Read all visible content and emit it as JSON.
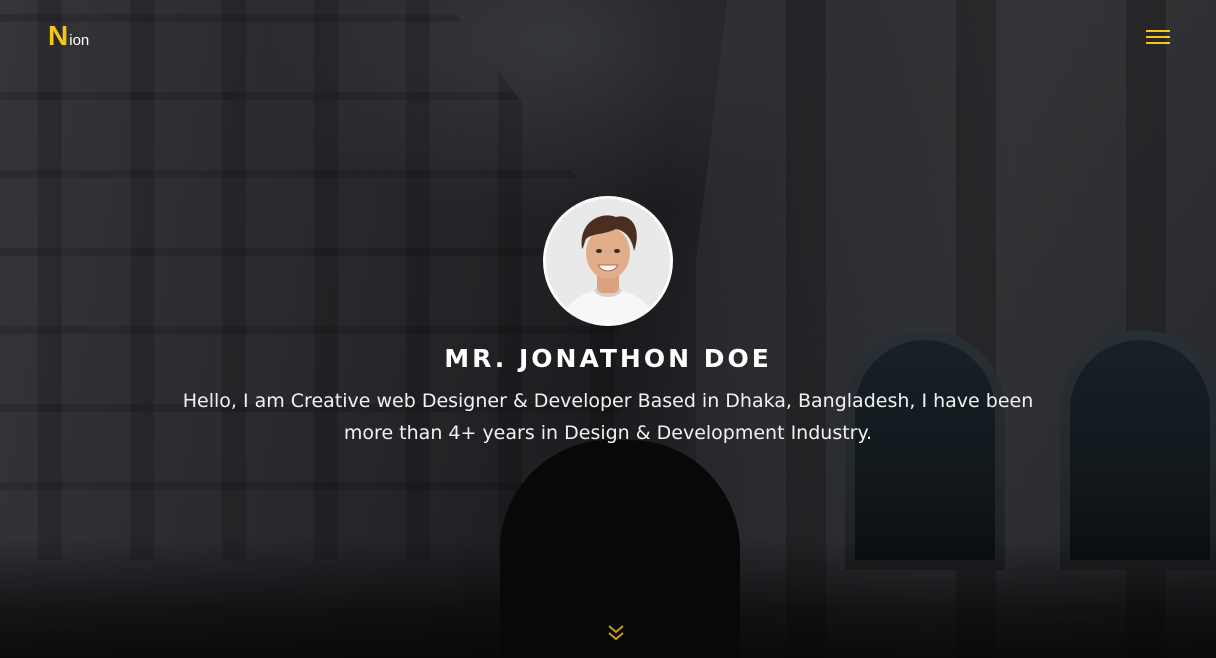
{
  "brand": {
    "mark": "N",
    "text": "ion",
    "accent_color": "#f5c518"
  },
  "nav": {
    "menu_icon": "hamburger-menu-icon"
  },
  "profile": {
    "name": "MR. JONATHON DOE",
    "bio": "Hello, I am Creative web Designer & Developer Based in Dhaka, Bangladesh, I have been more than 4+ years in Design & Development Industry."
  },
  "scroll": {
    "icon": "double-chevron-down-icon"
  }
}
